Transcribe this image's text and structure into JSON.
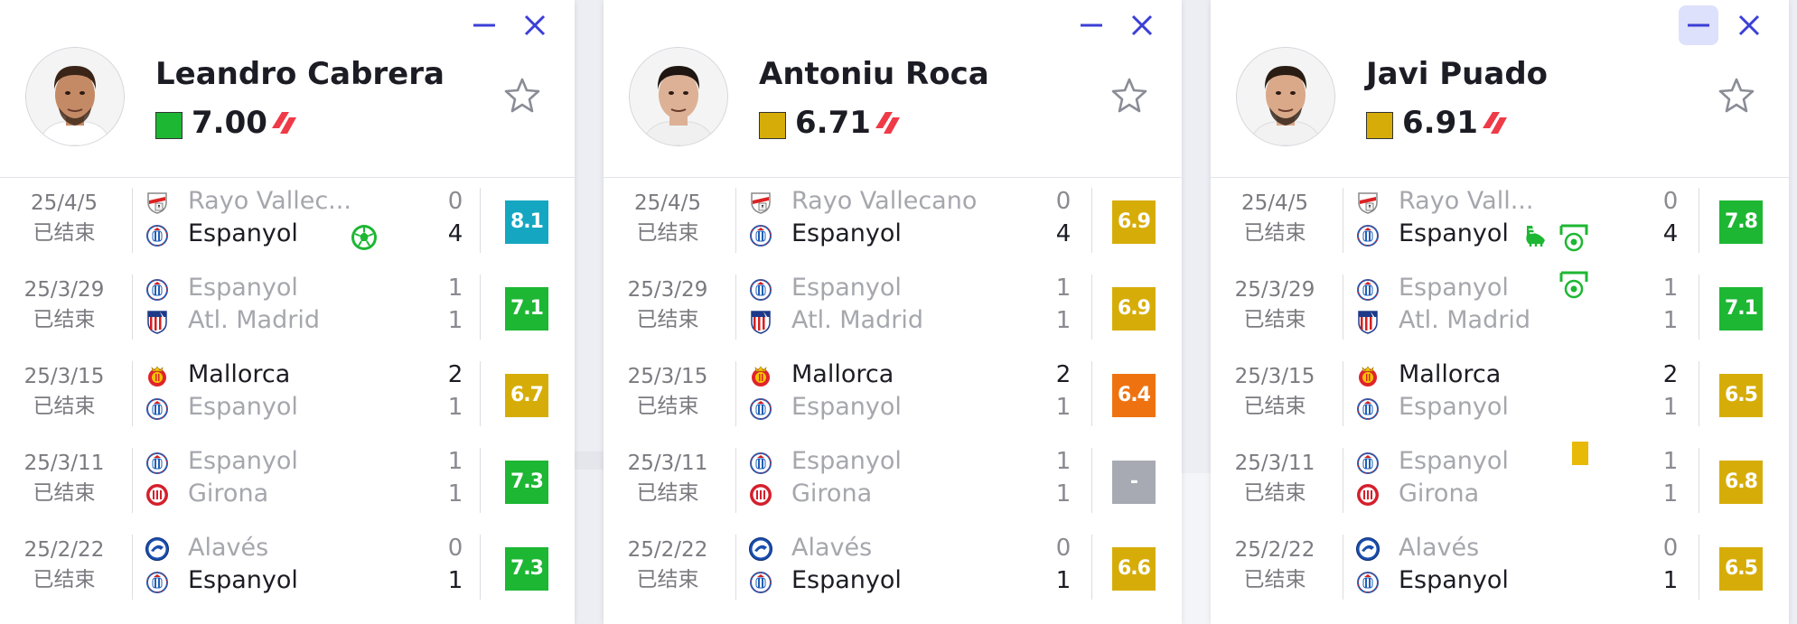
{
  "status_label": "已结束",
  "colors": {
    "green": "#1db733",
    "gold": "#d6ad08",
    "orange": "#ee7310",
    "teal": "#15a7c1",
    "grey": "#a8aab3",
    "accent": "#3b3fd6"
  },
  "players": [
    {
      "name": "Leandro Cabrera",
      "rating": "7.00",
      "rating_color": "#1db733",
      "league_icon": "laliga-icon",
      "matches": [
        {
          "date": "25/4/5",
          "home": "Rayo Vallec...",
          "home_crest": "rayo-crest",
          "away": "Espanyol",
          "away_crest": "espanyol-crest",
          "home_score": "0",
          "away_score": "4",
          "winner": "away",
          "rating": "8.1",
          "rating_color": "#15a7c1",
          "events": [
            "goal-icon"
          ]
        },
        {
          "date": "25/3/29",
          "home": "Espanyol",
          "home_crest": "espanyol-crest",
          "away": "Atl. Madrid",
          "away_crest": "atletico-crest",
          "home_score": "1",
          "away_score": "1",
          "winner": "none",
          "rating": "7.1",
          "rating_color": "#1db733",
          "events": []
        },
        {
          "date": "25/3/15",
          "home": "Mallorca",
          "home_crest": "mallorca-crest",
          "away": "Espanyol",
          "away_crest": "espanyol-crest",
          "home_score": "2",
          "away_score": "1",
          "winner": "home",
          "rating": "6.7",
          "rating_color": "#d6ad08",
          "events": []
        },
        {
          "date": "25/3/11",
          "home": "Espanyol",
          "home_crest": "espanyol-crest",
          "away": "Girona",
          "away_crest": "girona-crest",
          "home_score": "1",
          "away_score": "1",
          "winner": "none",
          "rating": "7.3",
          "rating_color": "#1db733",
          "events": []
        },
        {
          "date": "25/2/22",
          "home": "Alavés",
          "home_crest": "alaves-crest",
          "away": "Espanyol",
          "away_crest": "espanyol-crest",
          "home_score": "0",
          "away_score": "1",
          "winner": "away",
          "rating": "7.3",
          "rating_color": "#1db733",
          "events": []
        }
      ]
    },
    {
      "name": "Antoniu Roca",
      "rating": "6.71",
      "rating_color": "#d6ad08",
      "league_icon": "laliga-icon",
      "matches": [
        {
          "date": "25/4/5",
          "home": "Rayo Vallecano",
          "home_crest": "rayo-crest",
          "away": "Espanyol",
          "away_crest": "espanyol-crest",
          "home_score": "0",
          "away_score": "4",
          "winner": "away",
          "rating": "6.9",
          "rating_color": "#d6ad08",
          "events": []
        },
        {
          "date": "25/3/29",
          "home": "Espanyol",
          "home_crest": "espanyol-crest",
          "away": "Atl. Madrid",
          "away_crest": "atletico-crest",
          "home_score": "1",
          "away_score": "1",
          "winner": "none",
          "rating": "6.9",
          "rating_color": "#d6ad08",
          "events": []
        },
        {
          "date": "25/3/15",
          "home": "Mallorca",
          "home_crest": "mallorca-crest",
          "away": "Espanyol",
          "away_crest": "espanyol-crest",
          "home_score": "2",
          "away_score": "1",
          "winner": "home",
          "rating": "6.4",
          "rating_color": "#ee7310",
          "events": []
        },
        {
          "date": "25/3/11",
          "home": "Espanyol",
          "home_crest": "espanyol-crest",
          "away": "Girona",
          "away_crest": "girona-crest",
          "home_score": "1",
          "away_score": "1",
          "winner": "none",
          "rating": "-",
          "rating_color": "#a8aab3",
          "events": []
        },
        {
          "date": "25/2/22",
          "home": "Alavés",
          "home_crest": "alaves-crest",
          "away": "Espanyol",
          "away_crest": "espanyol-crest",
          "home_score": "0",
          "away_score": "1",
          "winner": "away",
          "rating": "6.6",
          "rating_color": "#d6ad08",
          "events": []
        }
      ]
    },
    {
      "name": "Javi Puado",
      "rating": "6.91",
      "rating_color": "#d6ad08",
      "league_icon": "laliga-icon",
      "matches": [
        {
          "date": "25/4/5",
          "home": "Rayo Vall...",
          "home_crest": "rayo-crest",
          "away": "Espanyol",
          "away_crest": "espanyol-crest",
          "home_score": "0",
          "away_score": "4",
          "winner": "away",
          "rating": "7.8",
          "rating_color": "#1db733",
          "events": [
            "assist-boot-icon",
            "penalty-goal-icon"
          ]
        },
        {
          "date": "25/3/29",
          "home": "Espanyol",
          "home_crest": "espanyol-crest",
          "away": "Atl. Madrid",
          "away_crest": "atletico-crest",
          "home_score": "1",
          "away_score": "1",
          "winner": "none",
          "rating": "7.1",
          "rating_color": "#1db733",
          "events": [
            "penalty-goal-icon"
          ]
        },
        {
          "date": "25/3/15",
          "home": "Mallorca",
          "home_crest": "mallorca-crest",
          "away": "Espanyol",
          "away_crest": "espanyol-crest",
          "home_score": "2",
          "away_score": "1",
          "winner": "home",
          "rating": "6.5",
          "rating_color": "#d6ad08",
          "events": []
        },
        {
          "date": "25/3/11",
          "home": "Espanyol",
          "home_crest": "espanyol-crest",
          "away": "Girona",
          "away_crest": "girona-crest",
          "home_score": "1",
          "away_score": "1",
          "winner": "none",
          "rating": "6.8",
          "rating_color": "#d6ad08",
          "events": [
            "yellow-card-icon"
          ]
        },
        {
          "date": "25/2/22",
          "home": "Alavés",
          "home_crest": "alaves-crest",
          "away": "Espanyol",
          "away_crest": "espanyol-crest",
          "home_score": "0",
          "away_score": "1",
          "winner": "away",
          "rating": "6.5",
          "rating_color": "#d6ad08",
          "events": []
        }
      ]
    }
  ]
}
